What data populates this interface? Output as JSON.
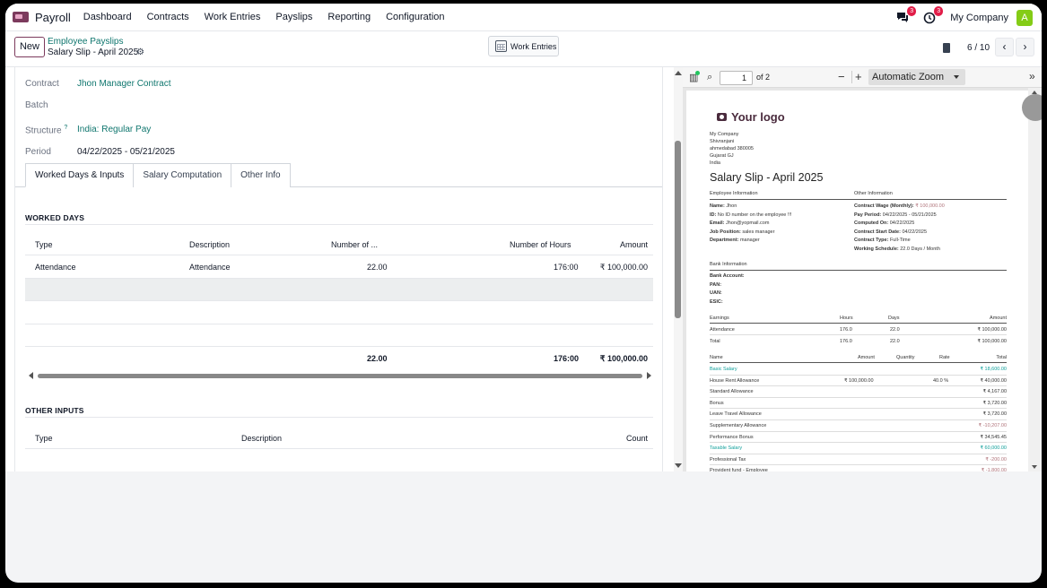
{
  "navbar": {
    "app_name": "Payroll",
    "menu": [
      "Dashboard",
      "Contracts",
      "Work Entries",
      "Payslips",
      "Reporting",
      "Configuration"
    ],
    "chat_badge": "3",
    "activity_badge": "3",
    "company": "My Company",
    "avatar_letter": "A"
  },
  "control_panel": {
    "new_label": "New",
    "breadcrumb_parent": "Employee Payslips",
    "breadcrumb_current": "Salary Slip - April 2025",
    "work_entries_label": "Work Entries",
    "pager_value": "6 / 10",
    "prev": "‹",
    "next": "›"
  },
  "form": {
    "contract_label": "Contract",
    "contract_value": "Jhon Manager Contract",
    "batch_label": "Batch",
    "structure_label": "Structure",
    "structure_help": "?",
    "structure_value": "India: Regular Pay",
    "period_label": "Period",
    "period_value": "04/22/2025 - 05/21/2025",
    "tabs": [
      "Worked Days & Inputs",
      "Salary Computation",
      "Other Info"
    ]
  },
  "worked_days": {
    "title": "WORKED DAYS",
    "headers": [
      "Type",
      "Description",
      "Number of ...",
      "Number of Hours",
      "Amount"
    ],
    "rows": [
      {
        "type": "Attendance",
        "description": "Attendance",
        "days": "22.00",
        "hours": "176:00",
        "amount": "₹ 100,000.00"
      }
    ],
    "totals": {
      "days": "22.00",
      "hours": "176:00",
      "amount": "₹ 100,000.00"
    }
  },
  "other_inputs": {
    "title": "OTHER INPUTS",
    "headers": [
      "Type",
      "Description",
      "Count"
    ]
  },
  "pdf_viewer": {
    "page_number": "1",
    "page_of": "of 2",
    "zoom": "Automatic Zoom",
    "logo_text": "Your logo",
    "address_lines": [
      "My Company",
      "Shivranjani",
      "ahmedabad 380005",
      "Gujarat GJ",
      "India"
    ],
    "title": "Salary Slip - April 2025",
    "employee_info_heading": "Employee Information",
    "other_info_heading": "Other Information",
    "employee_info": [
      {
        "label": "Name:",
        "value": "Jhon"
      },
      {
        "label": "ID:",
        "value": "No ID number on the employee !!!"
      },
      {
        "label": "Email:",
        "value": "Jhon@yopmail.com"
      },
      {
        "label": "Job Position:",
        "value": "sales manager"
      },
      {
        "label": "Department:",
        "value": "manager"
      }
    ],
    "other_info": [
      {
        "label": "Contract Wage (Monthly):",
        "value": "₹ 100,000.00"
      },
      {
        "label": "Pay Period:",
        "value": "04/22/2025 - 05/21/2025"
      },
      {
        "label": "Computed On:",
        "value": "04/22/2025"
      },
      {
        "label": "Contract Start Date:",
        "value": "04/22/2025"
      },
      {
        "label": "Contract Type:",
        "value": "Full-Time"
      },
      {
        "label": "Working Schedule:",
        "value": "22.0 Days / Month"
      }
    ],
    "bank_heading": "Bank Information",
    "bank_fields": [
      "Bank Account:",
      "PAN:",
      "UAN:",
      "ESIC:"
    ],
    "earnings_headers": [
      "Earnings",
      "Hours",
      "Days",
      "Amount"
    ],
    "earnings_rows": [
      {
        "name": "Attendance",
        "hours": "176.0",
        "days": "22.0",
        "amount": "₹ 100,000.00"
      },
      {
        "name": "Total",
        "hours": "176.0",
        "days": "22.0",
        "amount": "₹ 100,000.00"
      }
    ],
    "lines_headers": [
      "Name",
      "Amount",
      "Quantity",
      "Rate",
      "Total"
    ],
    "lines": [
      {
        "name": "Basic Salary",
        "amount": "",
        "rate": "",
        "total": "₹ 18,600.00",
        "style": "teal"
      },
      {
        "name": "House Rent Allowance",
        "amount": "₹ 100,000.00",
        "rate": "40.0 %",
        "total": "₹ 40,000.00",
        "style": ""
      },
      {
        "name": "Standard Allowance",
        "amount": "",
        "rate": "",
        "total": "₹ 4,167.00",
        "style": ""
      },
      {
        "name": "Bonus",
        "amount": "",
        "rate": "",
        "total": "₹ 3,720.00",
        "style": ""
      },
      {
        "name": "Leave Travel Allowance",
        "amount": "",
        "rate": "",
        "total": "₹ 3,720.00",
        "style": ""
      },
      {
        "name": "Supplementary Allowance",
        "amount": "",
        "rate": "",
        "total": "₹ -10,207.00",
        "style": "red-total"
      },
      {
        "name": "Performance Bonus",
        "amount": "",
        "rate": "",
        "total": "₹ 34,545.45",
        "style": ""
      },
      {
        "name": "Taxable Salary",
        "amount": "",
        "rate": "",
        "total": "₹ 60,000.00",
        "style": "teal"
      },
      {
        "name": "Professional Tax",
        "amount": "",
        "rate": "",
        "total": "₹ -200.00",
        "style": "red-total"
      },
      {
        "name": "Provident fund - Employee",
        "amount": "",
        "rate": "",
        "total": "₹ -1,800.00",
        "style": "red-total"
      }
    ]
  }
}
